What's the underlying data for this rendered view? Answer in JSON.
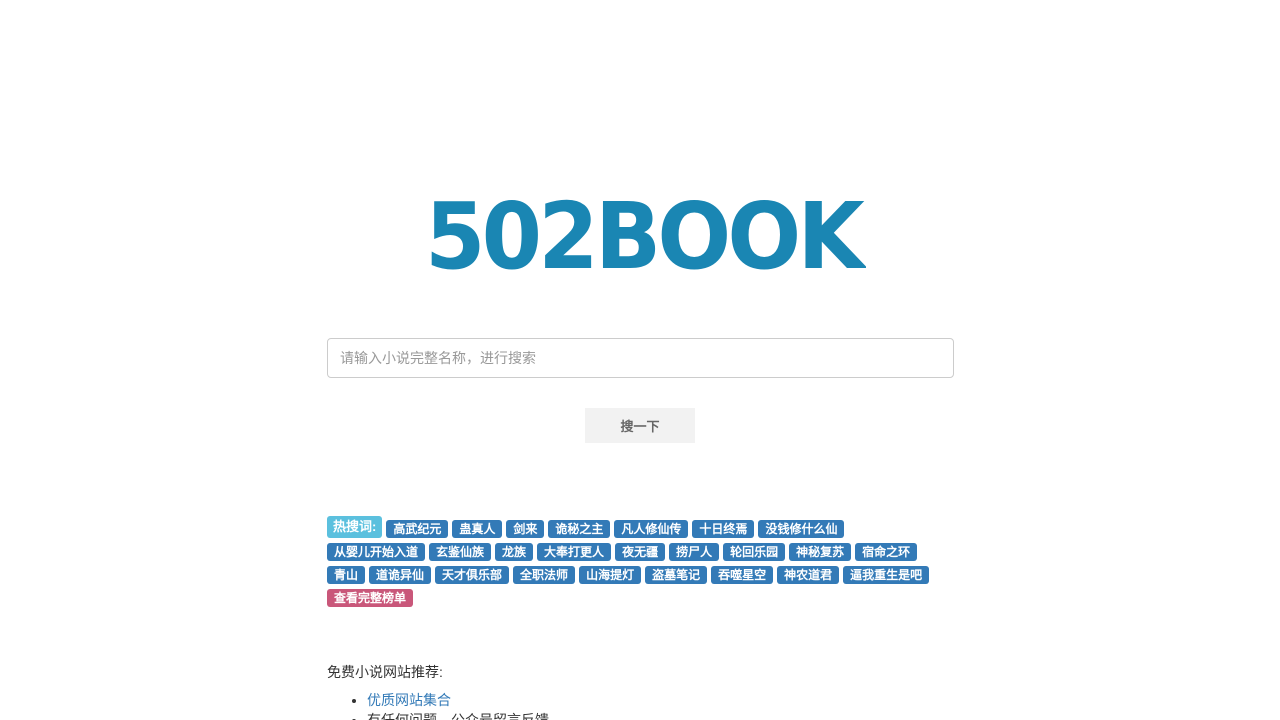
{
  "logo": {
    "text": "502BOOK",
    "color": "#1a86b3"
  },
  "search": {
    "placeholder": "请输入小说完整名称，进行搜索",
    "button_label": "搜一下"
  },
  "hot": {
    "label": "热搜词:",
    "rows": [
      [
        "高武纪元",
        "蛊真人",
        "剑来",
        "诡秘之主",
        "凡人修仙传",
        "十日终焉",
        "没钱修什么仙"
      ],
      [
        "从婴儿开始入道",
        "玄鉴仙族",
        "龙族",
        "大奉打更人",
        "夜无疆",
        "捞尸人",
        "轮回乐园",
        "神秘复苏",
        "宿命之环"
      ],
      [
        "青山",
        "道诡异仙",
        "天才俱乐部",
        "全职法师",
        "山海提灯",
        "盗墓笔记",
        "吞噬星空",
        "神农道君",
        "逼我重生是吧"
      ]
    ],
    "full_list_label": "查看完整榜单",
    "colors": {
      "label": "#5bc0de",
      "tag": "#337ab7",
      "full": "#c9577a"
    }
  },
  "recommend": {
    "title": "免费小说网站推荐:",
    "items": [
      {
        "text": "优质网站集合",
        "link": true
      },
      {
        "text": "有任何问题，公众号留言反馈",
        "link": false
      }
    ]
  }
}
